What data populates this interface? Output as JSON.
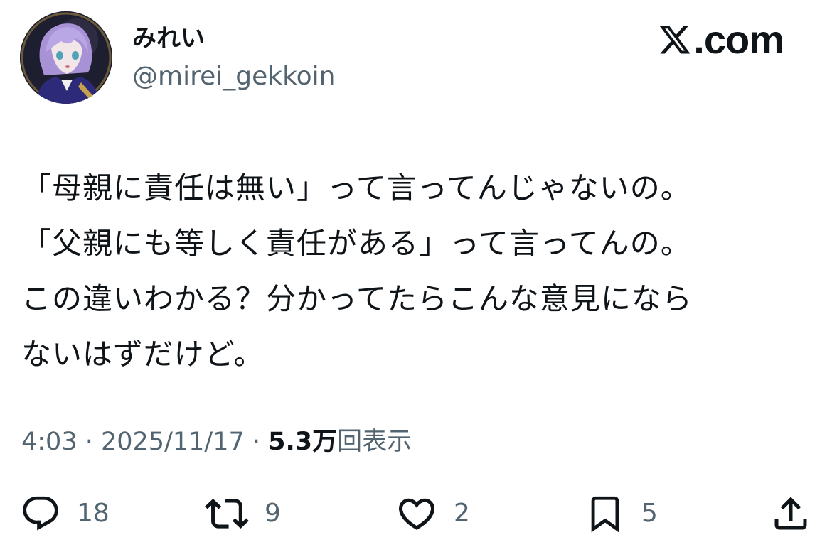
{
  "user": {
    "display_name": "みれい",
    "handle": "@mirei_gekkoin",
    "avatar_icon": "avatar-illustration"
  },
  "brand": {
    "text": ".com",
    "icon": "x-logo-icon"
  },
  "tweet": {
    "lines": [
      "「母親に責任は無い」って言ってんじゃないの。",
      "「父親にも等しく責任がある」って言ってんの。",
      "この違いわかる？分かってたらこんな意見になら",
      "ないはずだけど。"
    ]
  },
  "meta": {
    "time": "4:03",
    "separator1": " · ",
    "date": "2025/11/17",
    "separator2": " · ",
    "views_count": "5.3万",
    "views_label": "回表示"
  },
  "actions": {
    "reply": {
      "icon": "reply-icon",
      "count": "18"
    },
    "repost": {
      "icon": "repost-icon",
      "count": "9"
    },
    "like": {
      "icon": "heart-icon",
      "count": "2"
    },
    "bookmark": {
      "icon": "bookmark-icon",
      "count": "5"
    },
    "share": {
      "icon": "share-icon"
    }
  },
  "colors": {
    "text_primary": "#0f1419",
    "text_secondary": "#536471",
    "background": "#ffffff"
  }
}
